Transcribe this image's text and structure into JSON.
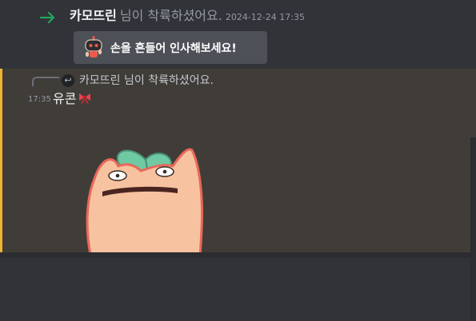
{
  "join_message": {
    "username": "카모뜨린",
    "text": "님이 착륙하셨어요.",
    "timestamp": "2024-12-24 17:35",
    "wave_button_label": "손을 흔들어 인사해보세요!"
  },
  "message": {
    "reply": {
      "username": "카모뜨린",
      "text": "님이 착륙하셨어요."
    },
    "time": "17:35",
    "content": "유콘"
  },
  "icons": {
    "join": "arrow-right-icon",
    "wave": "robot-wave-icon",
    "reply_avatar": "reply-avatar-icon",
    "emoji": "ribbon-emoji-icon",
    "sticker": "peach-character-sticker"
  },
  "colors": {
    "background": "#313338",
    "highlight_background": "#403c38",
    "mention_accent": "#f0b232",
    "join_arrow": "#23a55a",
    "button": "#4e5058"
  }
}
